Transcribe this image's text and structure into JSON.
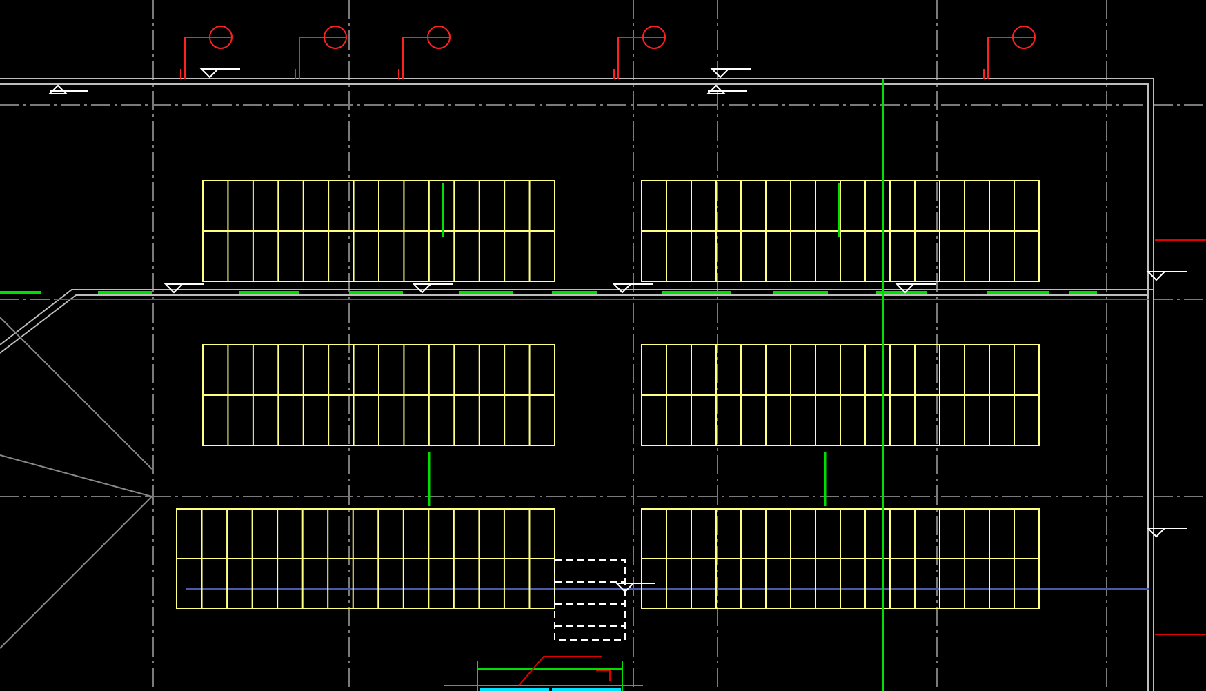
{
  "parking_blocks": [
    {
      "kind": "double-row"
    },
    {
      "kind": "double-row"
    },
    {
      "kind": "double-row"
    },
    {
      "kind": "double-row"
    },
    {
      "kind": "double-row"
    },
    {
      "kind": "double-row"
    }
  ],
  "callouts": [
    {
      "kind": "section-mark"
    },
    {
      "kind": "section-mark"
    },
    {
      "kind": "section-mark"
    },
    {
      "kind": "section-mark"
    },
    {
      "kind": "section-mark"
    }
  ]
}
